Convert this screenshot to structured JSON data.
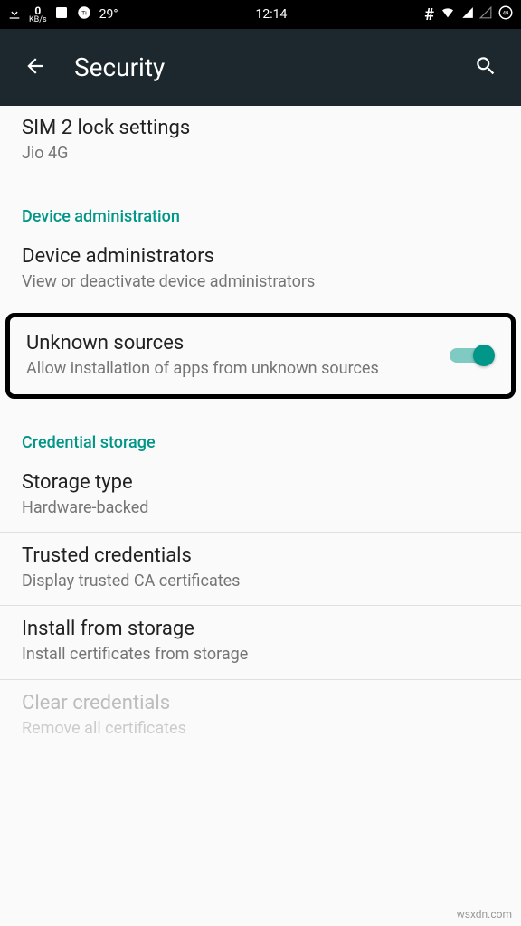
{
  "status": {
    "speed_value": "0",
    "speed_unit": "KB/s",
    "temp": "29°",
    "time": "12:14",
    "battery": "49"
  },
  "appbar": {
    "title": "Security"
  },
  "items": {
    "sim2": {
      "title": "SIM 2 lock settings",
      "subtitle": "Jio 4G"
    },
    "section_device_admin": "Device administration",
    "device_admins": {
      "title": "Device administrators",
      "subtitle": "View or deactivate device administrators"
    },
    "unknown_sources": {
      "title": "Unknown sources",
      "subtitle": "Allow installation of apps from unknown sources",
      "enabled": true
    },
    "section_cred_storage": "Credential storage",
    "storage_type": {
      "title": "Storage type",
      "subtitle": "Hardware-backed"
    },
    "trusted_creds": {
      "title": "Trusted credentials",
      "subtitle": "Display trusted CA certificates"
    },
    "install_storage": {
      "title": "Install from storage",
      "subtitle": "Install certificates from storage"
    },
    "clear_creds": {
      "title": "Clear credentials",
      "subtitle": "Remove all certificates"
    }
  },
  "watermark": "wsxdn.com"
}
